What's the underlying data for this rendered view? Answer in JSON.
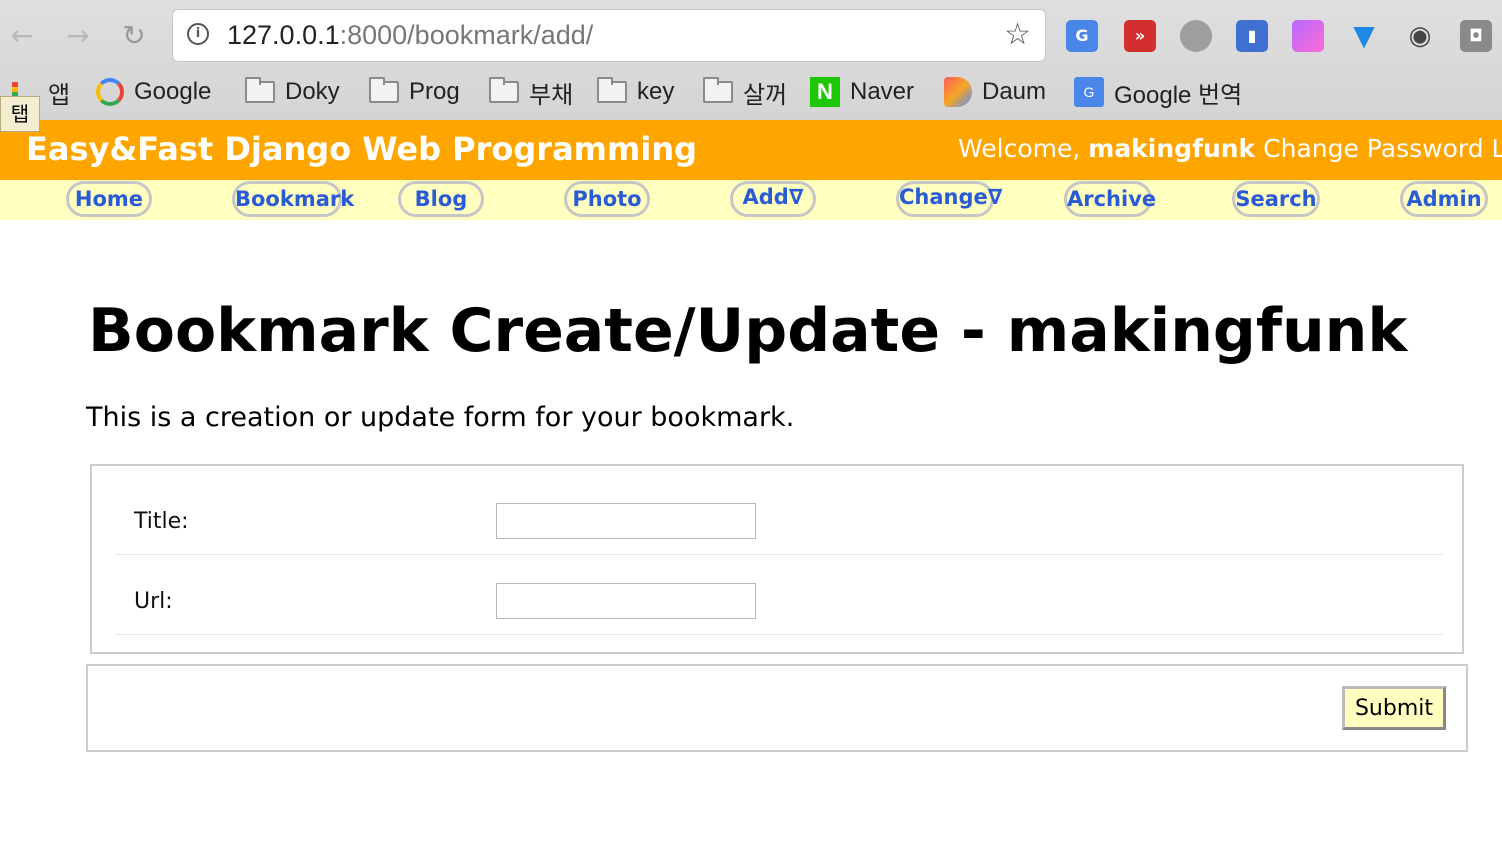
{
  "browser": {
    "url_host": "127.0.0.1",
    "url_path": ":8000/bookmark/add/",
    "bookmarks": [
      {
        "label": "앱",
        "icon": "apps-icon"
      },
      {
        "label": "Google",
        "icon": "google-icon"
      },
      {
        "label": "Doky",
        "icon": "folder-icon"
      },
      {
        "label": "Prog",
        "icon": "folder-icon"
      },
      {
        "label": "부채",
        "icon": "folder-icon"
      },
      {
        "label": "key",
        "icon": "folder-icon"
      },
      {
        "label": "살꺼",
        "icon": "folder-icon"
      },
      {
        "label": "Naver",
        "icon": "naver-icon"
      },
      {
        "label": "Daum",
        "icon": "daum-icon"
      },
      {
        "label": "Google 번역",
        "icon": "google-translate-icon"
      }
    ],
    "tab_tooltip": "탭"
  },
  "site": {
    "title": "Easy&Fast Django Web Programming",
    "welcome_prefix": "Welcome,",
    "username": "makingfunk",
    "change_password": "Change Password",
    "logout": "Logout",
    "menu": [
      "Home",
      "Bookmark",
      "Blog",
      "Photo",
      "Add∇",
      "Change∇",
      "Archive",
      "Search",
      "Admin"
    ],
    "colors": {
      "header": "#ffa500",
      "menubar": "#ffffc0",
      "menu_text": "#2a5bd7"
    }
  },
  "main": {
    "heading": "Bookmark Create/Update - makingfunk",
    "description": "This is a creation or update form for your bookmark.",
    "fields": [
      {
        "label": "Title:",
        "value": ""
      },
      {
        "label": "Url:",
        "value": ""
      }
    ],
    "submit_label": "Submit"
  }
}
